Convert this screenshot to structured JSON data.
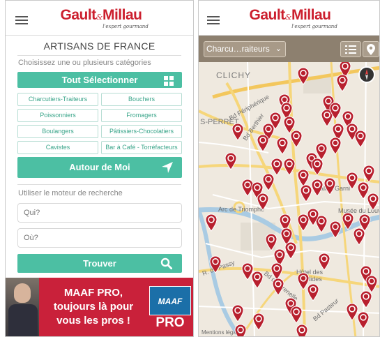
{
  "left_screen": {
    "logo": {
      "main": "Gault",
      "amp": "&",
      "main2": "Millau",
      "tagline": "l'expert gourmand"
    },
    "page_title": "ARTISANS DE FRANCE",
    "subtitle": "Choisissez une ou plusieurs catégories",
    "select_all_label": "Tout Sélectionner",
    "categories": [
      "Charcutiers-Traiteurs",
      "Bouchers",
      "Poissonniers",
      "Fromagers",
      "Boulangers",
      "Pâtissiers-Chocolatiers",
      "Cavistes",
      "Bar à Café - Torréfacteurs"
    ],
    "nearby_label": "Autour de Moi",
    "search_hint": "Utiliser le moteur de recherche",
    "who_placeholder": "Qui?",
    "where_placeholder": "Où?",
    "find_label": "Trouver",
    "ad": {
      "line1": "MAAF PRO,",
      "line2": "toujours là pour",
      "line3": "vous les pros !",
      "brand": "MAAF",
      "pro": "PRO"
    }
  },
  "right_screen": {
    "logo": {
      "main": "Gault",
      "amp": "&",
      "main2": "Millau",
      "tagline": "l'expert gourmand"
    },
    "category_select": "Charcu…raiteurs",
    "map_labels": {
      "clichy": "CLICHY",
      "periph": "Bd Périphérique",
      "berthier": "Bd Berthier",
      "perret": "S-PERRET",
      "arc": "Arc de Triomphe",
      "garnier": "Palais Garni",
      "louvre": "Musée du Louv",
      "invalides": "Hôtel des Invalides",
      "passy": "R. de Passy",
      "grenelle": "Bd de Grenelle",
      "pasteur": "Bd Pasteur",
      "mentions": "Mentions légales"
    }
  },
  "colors": {
    "brand_red": "#cc1f2e",
    "teal": "#4cbfa3",
    "pin_red": "#b8202e",
    "map_bar": "#8d806f",
    "ad_red": "#c9213a"
  },
  "icons": [
    "menu-icon",
    "grid-icon",
    "location-arrow-icon",
    "search-icon",
    "list-icon",
    "map-marker-icon",
    "compass-icon"
  ]
}
